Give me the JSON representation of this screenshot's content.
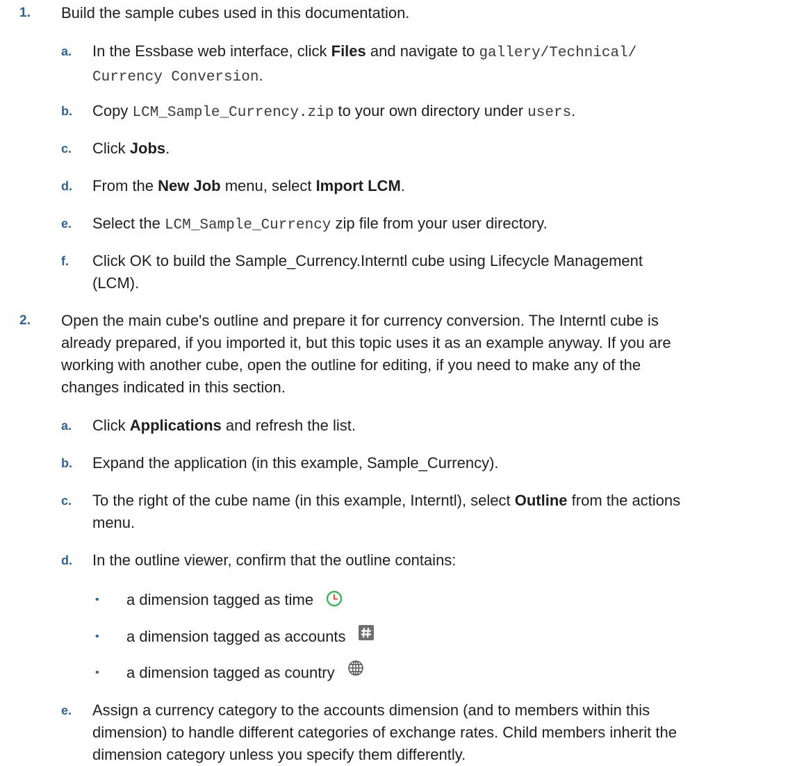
{
  "steps": [
    {
      "num": "1.",
      "text": "Build the sample cubes used in this documentation.",
      "subs": [
        {
          "letter": "a.",
          "pre": "In the Essbase web interface, click ",
          "bold": "Files",
          "mid": " and navigate to ",
          "code1": "gallery/Technical/",
          "code2": "Currency Conversion",
          "end": "."
        },
        {
          "letter": "b.",
          "pre": "Copy ",
          "code": "LCM_Sample_Currency.zip",
          "mid": " to your own directory under ",
          "code2": "users",
          "end": "."
        },
        {
          "letter": "c.",
          "pre": "Click ",
          "bold": "Jobs",
          "end": "."
        },
        {
          "letter": "d.",
          "pre": "From the ",
          "bold": "New Job",
          "mid": " menu, select ",
          "bold2": "Import LCM",
          "end": "."
        },
        {
          "letter": "e.",
          "pre": "Select the ",
          "code": "LCM_Sample_Currency",
          "end": " zip file from your user directory."
        },
        {
          "letter": "f.",
          "line1": "Click OK to build the Sample_Currency.Interntl cube using Lifecycle Management",
          "line2": "(LCM)."
        }
      ]
    },
    {
      "num": "2.",
      "lines": [
        "Open the main cube's outline and prepare it for currency conversion. The Interntl cube is",
        "already prepared, if you imported it, but this topic uses it as an example anyway. If you are",
        "working with another cube, open the outline for editing, if you need to make any of the",
        "changes indicated in this section."
      ],
      "subs": [
        {
          "letter": "a.",
          "pre": "Click ",
          "bold": "Applications",
          "end": " and refresh the list."
        },
        {
          "letter": "b.",
          "text": "Expand the application (in this example, Sample_Currency)."
        },
        {
          "letter": "c.",
          "pre": "To the right of the cube name (in this example, Interntl), select ",
          "bold": "Outline",
          "end": " from the actions",
          "line2": "menu."
        },
        {
          "letter": "d.",
          "text": "In the outline viewer, confirm that the outline contains:",
          "bullets": [
            {
              "text": "a dimension tagged as time",
              "icon": "clock-icon"
            },
            {
              "text": "a dimension tagged as accounts",
              "icon": "hash-icon"
            },
            {
              "text": "a dimension tagged as country",
              "icon": "globe-icon"
            }
          ]
        },
        {
          "letter": "e.",
          "lines": [
            "Assign a currency category to the accounts dimension (and to members within this",
            "dimension) to handle different categories of exchange rates. Child members inherit the",
            "dimension category unless you specify them differently."
          ]
        }
      ]
    }
  ],
  "colors": {
    "accent": "#2f6396",
    "text": "#1f1f1f",
    "clock": "#3bb35a",
    "hash_bg": "#6e6e6e"
  }
}
